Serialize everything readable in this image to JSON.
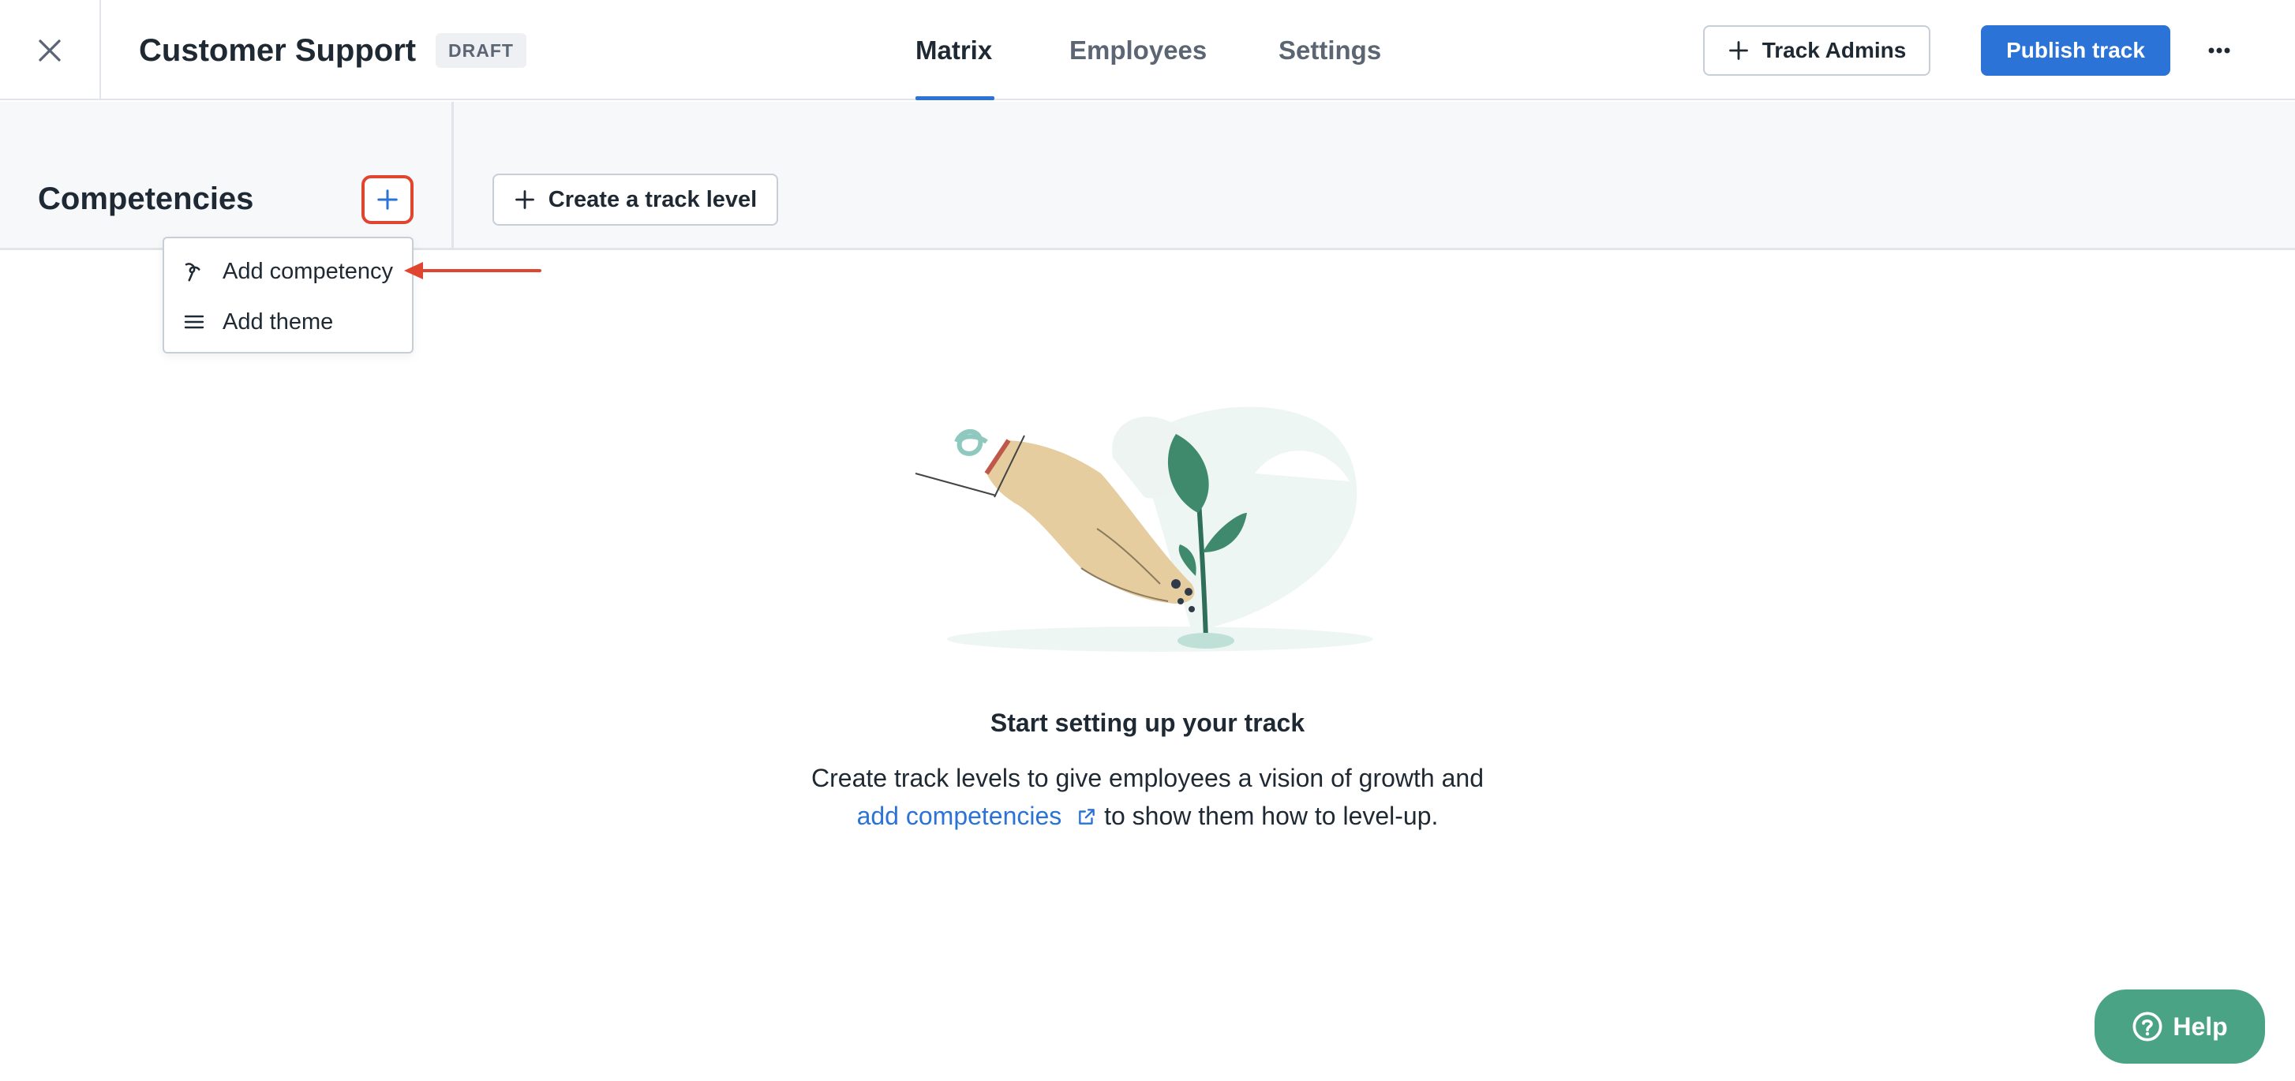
{
  "header": {
    "title": "Customer Support",
    "badge": "DRAFT",
    "tabs": [
      {
        "label": "Matrix",
        "active": true
      },
      {
        "label": "Employees",
        "active": false
      },
      {
        "label": "Settings",
        "active": false
      }
    ],
    "track_admins_label": "Track Admins",
    "publish_label": "Publish track"
  },
  "competencies": {
    "title": "Competencies",
    "create_level_label": "Create a track level"
  },
  "dropdown": {
    "items": [
      {
        "label": "Add competency",
        "icon": "competency-icon"
      },
      {
        "label": "Add theme",
        "icon": "list-icon"
      }
    ]
  },
  "empty_state": {
    "title": "Start setting up your track",
    "line1": "Create track levels to give employees a vision of growth and",
    "link": "add competencies",
    "line2_rest": " to show them how to level-up."
  },
  "help": {
    "label": "Help"
  },
  "colors": {
    "accent": "#2b73d6",
    "highlight": "#e0452f",
    "help": "#4ba386"
  }
}
